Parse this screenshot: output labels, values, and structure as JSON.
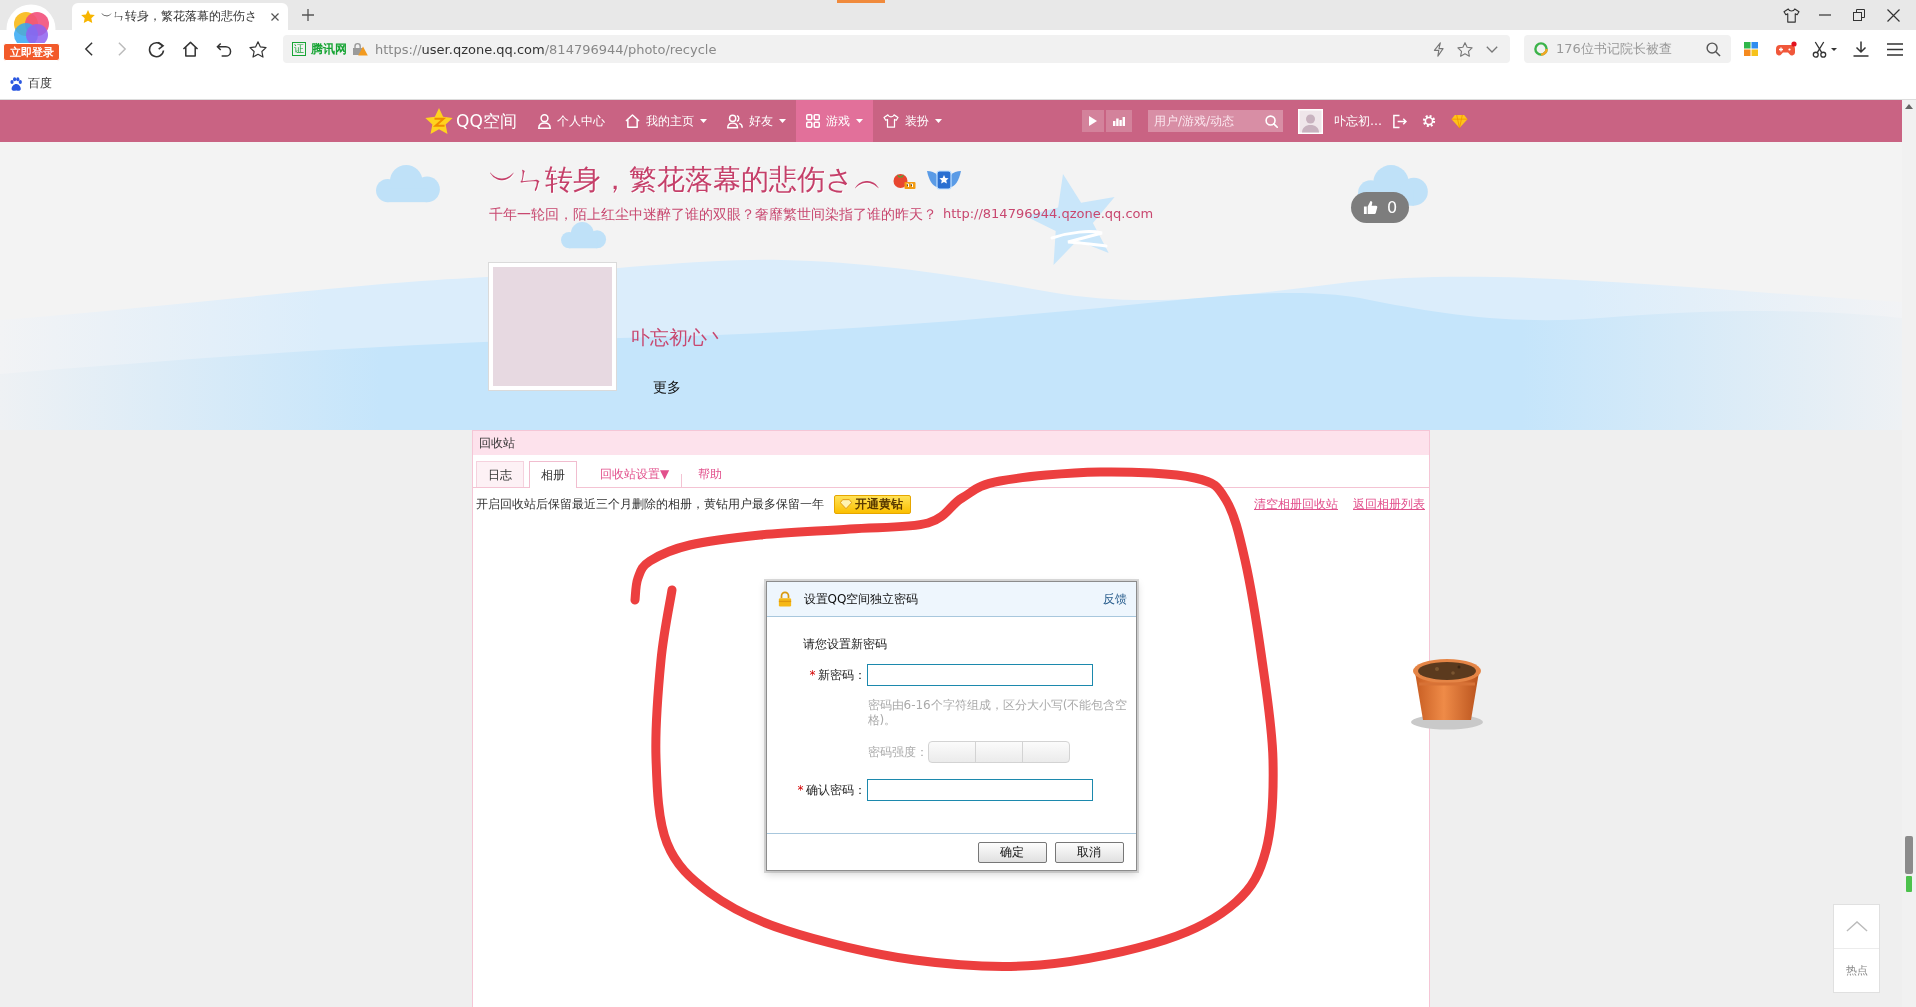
{
  "browser": {
    "login_badge": "立即登录",
    "tabs": [
      {
        "title": "︶ㄣ转身，繁花落幕的悲伤さ",
        "selected": true
      }
    ],
    "address": {
      "cert": "证",
      "site": "腾讯网",
      "scheme": "https://",
      "host": "user.qzone.qq.com",
      "path": "/814796944/photo/recycle"
    },
    "search": {
      "placeholder": "176位书记院长被查"
    },
    "bookmarks": [
      {
        "label": "百度"
      }
    ]
  },
  "nav": {
    "logo": "QQ空间",
    "items": [
      {
        "label": "个人中心",
        "dropdown": false,
        "selected": false
      },
      {
        "label": "我的主页",
        "dropdown": true,
        "selected": false
      },
      {
        "label": "好友",
        "dropdown": true,
        "selected": false
      },
      {
        "label": "游戏",
        "dropdown": true,
        "selected": true
      },
      {
        "label": "装扮",
        "dropdown": true,
        "selected": false
      }
    ],
    "search": {
      "placeholder": "用户/游戏/动态"
    },
    "user_name": "卟忘初…"
  },
  "header": {
    "title": "︶ㄣ转身，繁花落幕的悲伤さ︵",
    "motto": "千年一轮回，陌上红尘中迷醉了谁的双眼？奢靡繁世间染指了谁的昨天？",
    "url": "http://814796944.qzone.qq.com",
    "likes": "0",
    "nickname": "卟忘初心丶",
    "more": "更多"
  },
  "recycle": {
    "title": "回收站",
    "tabs": [
      {
        "label": "日志",
        "selected": false
      },
      {
        "label": "相册",
        "selected": true
      }
    ],
    "links": [
      "回收站设置▼",
      "帮助"
    ],
    "notice": "开启回收站后保留最近三个月删除的相册，黄钻用户最多保留一年",
    "vip_button": "开通黄钻",
    "actions": [
      "清空相册回收站",
      "返回相册列表"
    ]
  },
  "dialog": {
    "title": "设置QQ空间独立密码",
    "feedback": "反馈",
    "prompt": "请您设置新密码",
    "new_password": {
      "marker": "*",
      "label": "新密码："
    },
    "hint": "密码由6-16个字符组成，区分大小写(不能包含空格)。",
    "strength": {
      "label": "密码强度："
    },
    "confirm_password": {
      "marker": "*",
      "label": "确认密码："
    },
    "buttons": [
      "确定",
      "取消"
    ]
  },
  "side_widget": {
    "label": "热点"
  }
}
